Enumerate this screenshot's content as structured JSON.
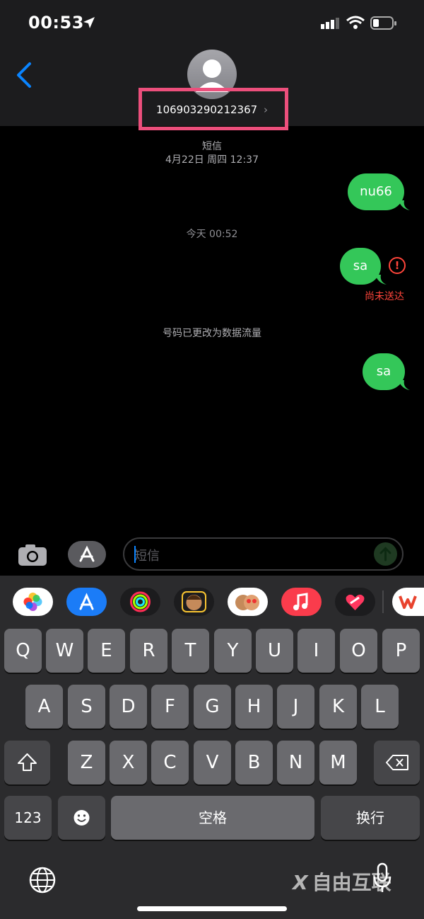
{
  "status_bar": {
    "time": "00:53"
  },
  "header": {
    "contact_number": "106903290212367"
  },
  "conversation": {
    "header_type": "短信",
    "header_date": "4月22日 周四 12:37",
    "messages": [
      {
        "text": "nu66",
        "from": "me"
      },
      {
        "divider": "今天 00:52"
      },
      {
        "text": "sa",
        "from": "me",
        "status": "尚未送达"
      },
      {
        "system": "号码已更改为数据流量"
      },
      {
        "text": "sa",
        "from": "me"
      }
    ]
  },
  "input": {
    "placeholder": "短信"
  },
  "keyboard": {
    "row1": [
      "Q",
      "W",
      "E",
      "R",
      "T",
      "Y",
      "U",
      "I",
      "O",
      "P"
    ],
    "row2": [
      "A",
      "S",
      "D",
      "F",
      "G",
      "H",
      "J",
      "K",
      "L"
    ],
    "row3": [
      "Z",
      "X",
      "C",
      "V",
      "B",
      "N",
      "M"
    ],
    "numbers_label": "123",
    "space_label": "空格",
    "return_label": "换行"
  },
  "watermark": "自由互联",
  "colors": {
    "bubble": "#34c759",
    "error": "#ff453a",
    "highlight": "#ec4f7c",
    "accent": "#0a84ff"
  }
}
